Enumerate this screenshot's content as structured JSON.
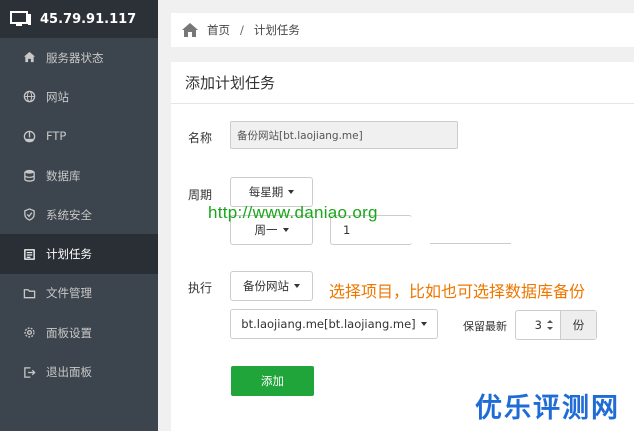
{
  "server": {
    "ip": "45.79.91.117"
  },
  "sidebar": {
    "items": [
      {
        "label": "服务器状态",
        "icon": "home-icon"
      },
      {
        "label": "网站",
        "icon": "globe-icon"
      },
      {
        "label": "FTP",
        "icon": "ftp-icon"
      },
      {
        "label": "数据库",
        "icon": "database-icon"
      },
      {
        "label": "系统安全",
        "icon": "shield-icon"
      },
      {
        "label": "计划任务",
        "icon": "task-icon",
        "active": true
      },
      {
        "label": "文件管理",
        "icon": "folder-icon"
      },
      {
        "label": "面板设置",
        "icon": "gear-icon"
      },
      {
        "label": "退出面板",
        "icon": "logout-icon"
      }
    ]
  },
  "breadcrumb": {
    "home": "首页",
    "separator": "/",
    "current": "计划任务"
  },
  "panel": {
    "title": "添加计划任务"
  },
  "form": {
    "name_label": "名称",
    "name_value": "备份网站[bt.laojiang.me]",
    "cycle_label": "周期",
    "cycle_value": "每星期",
    "weekday_value": "周一",
    "hour_value": "1",
    "exec_label": "执行",
    "exec_value": "备份网站",
    "target_value": "bt.laojiang.me[bt.laojiang.me]",
    "keep_label": "保留最新",
    "keep_value": "3",
    "keep_unit": "份",
    "submit_label": "添加"
  },
  "overlay": {
    "url": "http://www.daniao.org",
    "note": "选择项目，比如也可选择数据库备份",
    "watermark": "优乐评测网"
  },
  "colors": {
    "sidebar_bg": "#3c444d",
    "accent_green": "#20a53a",
    "url_green": "#1aa61a",
    "note_orange": "#ee7700",
    "watermark_blue": "#1f6cd6"
  }
}
